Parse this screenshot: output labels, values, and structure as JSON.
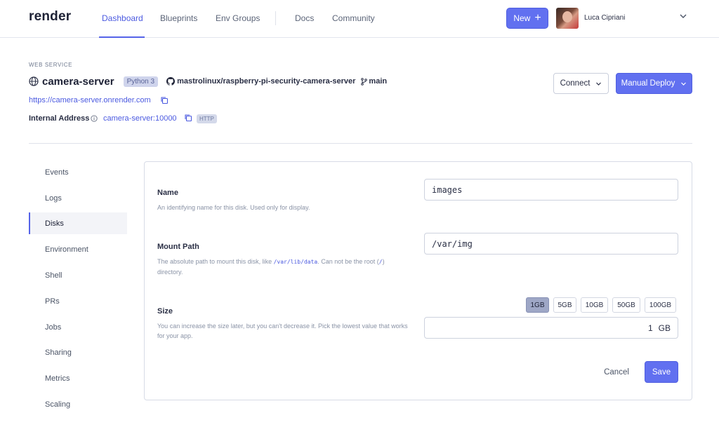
{
  "app": {
    "logo": "render"
  },
  "nav": {
    "links": [
      "Dashboard",
      "Blueprints",
      "Env Groups",
      "Docs",
      "Community"
    ],
    "new_label": "New",
    "user_name": "Luca Cipriani"
  },
  "service": {
    "type_label": "WEB SERVICE",
    "name": "camera-server",
    "runtime": "Python 3",
    "repo": "mastrolinux/raspberry-pi-security-camera-server",
    "branch": "main",
    "url": "https://camera-server.onrender.com",
    "internal_label": "Internal Address",
    "internal_address": "camera-server:10000",
    "protocol": "HTTP",
    "connect_label": "Connect",
    "deploy_label": "Manual Deploy"
  },
  "sidebar": {
    "items": [
      "Events",
      "Logs",
      "Disks",
      "Environment",
      "Shell",
      "PRs",
      "Jobs",
      "Sharing",
      "Metrics",
      "Scaling"
    ],
    "active": "Disks"
  },
  "disk_form": {
    "name_label": "Name",
    "name_help": "An identifying name for this disk. Used only for display.",
    "name_value": "images",
    "mount_label": "Mount Path",
    "mount_help_pre": "The absolute path to mount this disk, like ",
    "mount_help_code": "/var/lib/data",
    "mount_help_mid": ". Can not be the root (",
    "mount_help_code2": "/",
    "mount_help_post": ") directory.",
    "mount_value": "/var/img",
    "size_label": "Size",
    "size_help": "You can increase the size later, but you can't decrease it. Pick the lowest value that works for your app.",
    "size_options": [
      "1GB",
      "5GB",
      "10GB",
      "50GB",
      "100GB"
    ],
    "size_selected": "1GB",
    "size_value": "1",
    "size_unit": "GB",
    "cancel_label": "Cancel",
    "save_label": "Save"
  },
  "colors": {
    "accent": "#6170f0",
    "link": "#4b5ae0"
  }
}
